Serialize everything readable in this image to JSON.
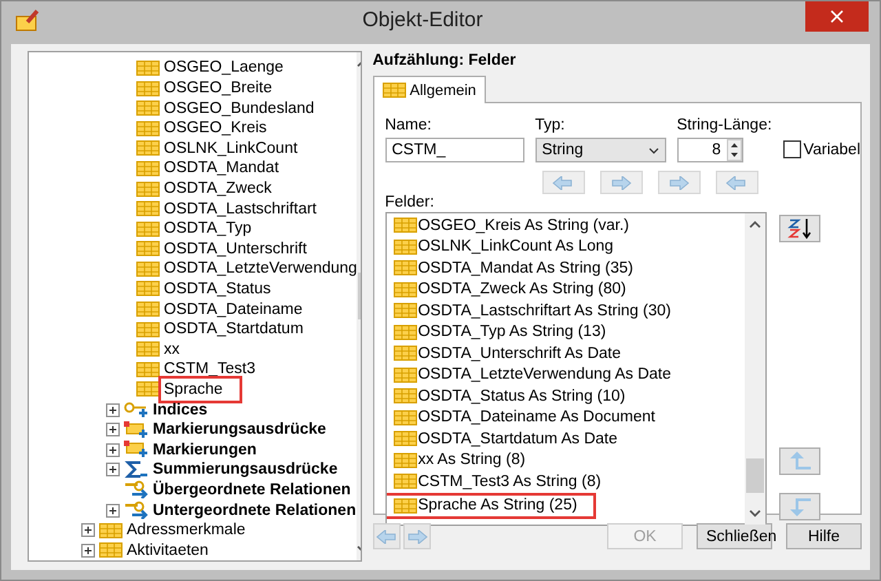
{
  "window": {
    "title": "Objekt-Editor"
  },
  "tree": {
    "fields": [
      {
        "label": "OSGEO_Laenge",
        "highlighted": false
      },
      {
        "label": "OSGEO_Breite",
        "highlighted": false
      },
      {
        "label": "OSGEO_Bundesland",
        "highlighted": false
      },
      {
        "label": "OSGEO_Kreis",
        "highlighted": false
      },
      {
        "label": "OSLNK_LinkCount",
        "highlighted": false
      },
      {
        "label": "OSDTA_Mandat",
        "highlighted": false
      },
      {
        "label": "OSDTA_Zweck",
        "highlighted": false
      },
      {
        "label": "OSDTA_Lastschriftart",
        "highlighted": false
      },
      {
        "label": "OSDTA_Typ",
        "highlighted": false
      },
      {
        "label": "OSDTA_Unterschrift",
        "highlighted": false
      },
      {
        "label": "OSDTA_LetzteVerwendung",
        "highlighted": false
      },
      {
        "label": "OSDTA_Status",
        "highlighted": false
      },
      {
        "label": "OSDTA_Dateiname",
        "highlighted": false
      },
      {
        "label": "OSDTA_Startdatum",
        "highlighted": false
      },
      {
        "label": "xx",
        "highlighted": false
      },
      {
        "label": "CSTM_Test3",
        "highlighted": false
      },
      {
        "label": "Sprache",
        "highlighted": true
      }
    ],
    "groups": [
      {
        "label": "Indices",
        "kind": "key",
        "expanded": false
      },
      {
        "label": "Markierungsausdrücke",
        "kind": "mark",
        "expanded": false
      },
      {
        "label": "Markierungen",
        "kind": "mark",
        "expanded": false
      },
      {
        "label": "Summierungsausdrücke",
        "kind": "sum",
        "expanded": false
      },
      {
        "label": "Übergeordnete Relationen",
        "kind": "relation"
      },
      {
        "label": "Untergeordnete Relationen",
        "kind": "relation",
        "expanded": false
      }
    ],
    "tables": [
      {
        "label": "Adressmerkmale",
        "expanded": false
      },
      {
        "label": "Aktivitaeten",
        "expanded": false
      }
    ]
  },
  "panel": {
    "heading": "Aufzählung: Felder",
    "tabs": [
      {
        "label": "Allgemein",
        "selected": true
      }
    ],
    "name": {
      "label": "Name:",
      "value": "CSTM_"
    },
    "type": {
      "label": "Typ:",
      "value": "String"
    },
    "length": {
      "label": "String-Länge:",
      "value": "8"
    },
    "variable": {
      "label": "Variabel",
      "checked": false
    },
    "fields_label": "Felder:",
    "fields": [
      {
        "label": "OSGEO_Kreis As String (var.)",
        "highlighted": false
      },
      {
        "label": "OSLNK_LinkCount As Long",
        "highlighted": false
      },
      {
        "label": "OSDTA_Mandat As String (35)",
        "highlighted": false
      },
      {
        "label": "OSDTA_Zweck As String (80)",
        "highlighted": false
      },
      {
        "label": "OSDTA_Lastschriftart As String (30)",
        "highlighted": false
      },
      {
        "label": "OSDTA_Typ As String (13)",
        "highlighted": false
      },
      {
        "label": "OSDTA_Unterschrift As Date",
        "highlighted": false
      },
      {
        "label": "OSDTA_LetzteVerwendung As Date",
        "highlighted": false
      },
      {
        "label": "OSDTA_Status As String (10)",
        "highlighted": false
      },
      {
        "label": "OSDTA_Dateiname As Document",
        "highlighted": false
      },
      {
        "label": "OSDTA_Startdatum As Date",
        "highlighted": false
      },
      {
        "label": "xx As String (8)",
        "highlighted": false
      },
      {
        "label": "CSTM_Test3 As String (8)",
        "highlighted": false
      },
      {
        "label": "Sprache As String (25)",
        "highlighted": true
      }
    ]
  },
  "buttons": [
    {
      "label": "OK",
      "disabled": true
    },
    {
      "label": "Schließen",
      "disabled": false
    },
    {
      "label": "Hilfe",
      "disabled": false
    }
  ]
}
